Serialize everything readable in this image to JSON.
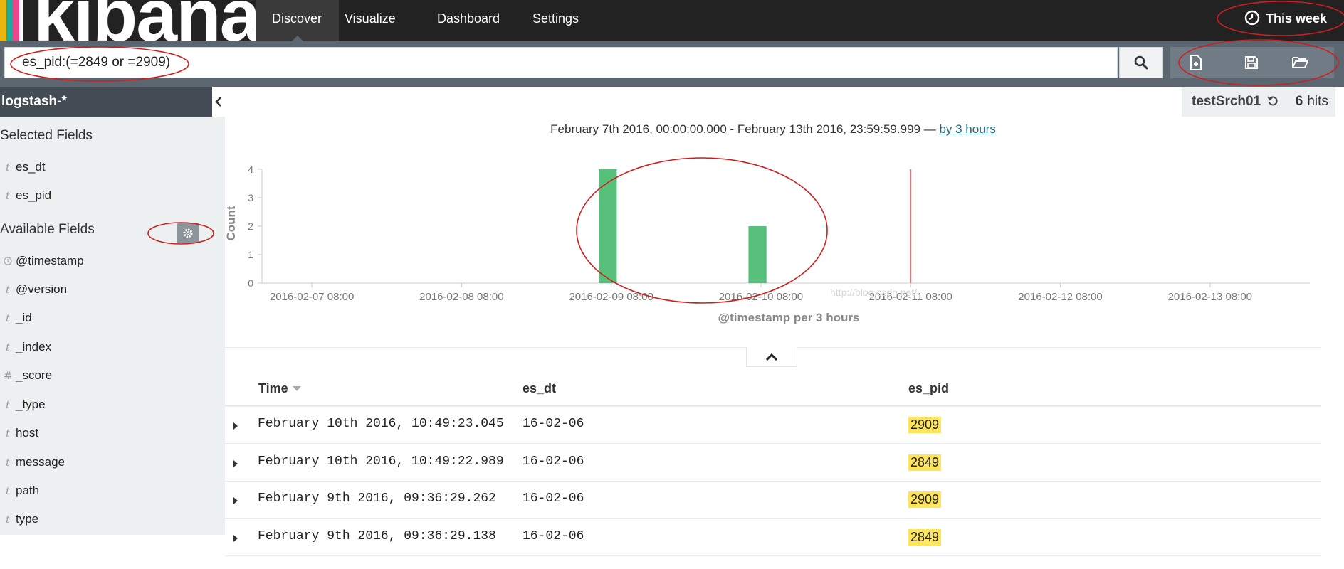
{
  "brand": {
    "name": "kibana",
    "stripe_colors": [
      "#e8b40e",
      "#1baa9a",
      "#e8488b",
      "#ffffff"
    ]
  },
  "nav": {
    "tabs": [
      {
        "label": "Discover",
        "active": true
      },
      {
        "label": "Visualize",
        "active": false
      },
      {
        "label": "Dashboard",
        "active": false
      },
      {
        "label": "Settings",
        "active": false
      }
    ],
    "time_picker": {
      "icon": "clock-icon",
      "label": "This week"
    }
  },
  "search": {
    "query": "es_pid:(=2849 or =2909)",
    "submit_icon": "search-icon",
    "actions": [
      {
        "name": "new-search-button",
        "icon": "new-document-icon"
      },
      {
        "name": "save-search-button",
        "icon": "floppy-disk-icon"
      },
      {
        "name": "open-search-button",
        "icon": "folder-open-icon"
      }
    ]
  },
  "sidebar": {
    "index_pattern": "logstash-*",
    "selected_heading": "Selected Fields",
    "selected_fields": [
      {
        "type": "t",
        "name": "es_dt"
      },
      {
        "type": "t",
        "name": "es_pid"
      }
    ],
    "available_heading": "Available Fields",
    "available_fields": [
      {
        "type": "clock",
        "name": "@timestamp"
      },
      {
        "type": "t",
        "name": "@version"
      },
      {
        "type": "t",
        "name": "_id"
      },
      {
        "type": "t",
        "name": "_index"
      },
      {
        "type": "#",
        "name": "_score"
      },
      {
        "type": "t",
        "name": "_type"
      },
      {
        "type": "t",
        "name": "host"
      },
      {
        "type": "t",
        "name": "message"
      },
      {
        "type": "t",
        "name": "path"
      },
      {
        "type": "t",
        "name": "type"
      }
    ]
  },
  "saved_search": {
    "name": "testSrch01",
    "hit_count": "6",
    "hits_label": "hits"
  },
  "time_range": {
    "text": "February 7th 2016, 00:00:00.000 - February 13th 2016, 23:59:59.999 —",
    "interval_link": "by 3 hours"
  },
  "chart_data": {
    "type": "bar",
    "xlabel": "@timestamp per 3 hours",
    "ylabel": "Count",
    "ylim": [
      0,
      4
    ],
    "y_ticks": [
      0,
      1,
      2,
      3,
      4
    ],
    "x_range": [
      "2016-02-07 00:00",
      "2016-02-14 00:00"
    ],
    "x_ticks": [
      "2016-02-07 08:00",
      "2016-02-08 08:00",
      "2016-02-09 08:00",
      "2016-02-10 08:00",
      "2016-02-11 08:00",
      "2016-02-12 08:00",
      "2016-02-13 08:00"
    ],
    "bars": [
      {
        "x": "2016-02-09 06:00",
        "value": 4
      },
      {
        "x": "2016-02-10 06:00",
        "value": 2
      }
    ],
    "current_time_marker": "2016-02-11 08:00",
    "bar_color": "#57c17b",
    "marker_color": "#e07a7a",
    "watermark": "http://blog.csdn.net/"
  },
  "table": {
    "columns": [
      "Time",
      "es_dt",
      "es_pid"
    ],
    "rows": [
      {
        "time": "February 10th 2016, 10:49:23.045",
        "es_dt": "16-02-06",
        "es_pid": "2909"
      },
      {
        "time": "February 10th 2016, 10:49:22.989",
        "es_dt": "16-02-06",
        "es_pid": "2849"
      },
      {
        "time": "February 9th 2016, 09:36:29.262",
        "es_dt": "16-02-06",
        "es_pid": "2909"
      },
      {
        "time": "February 9th 2016, 09:36:29.138",
        "es_dt": "16-02-06",
        "es_pid": "2849"
      }
    ]
  },
  "annotation_color": "#cc1f1f"
}
